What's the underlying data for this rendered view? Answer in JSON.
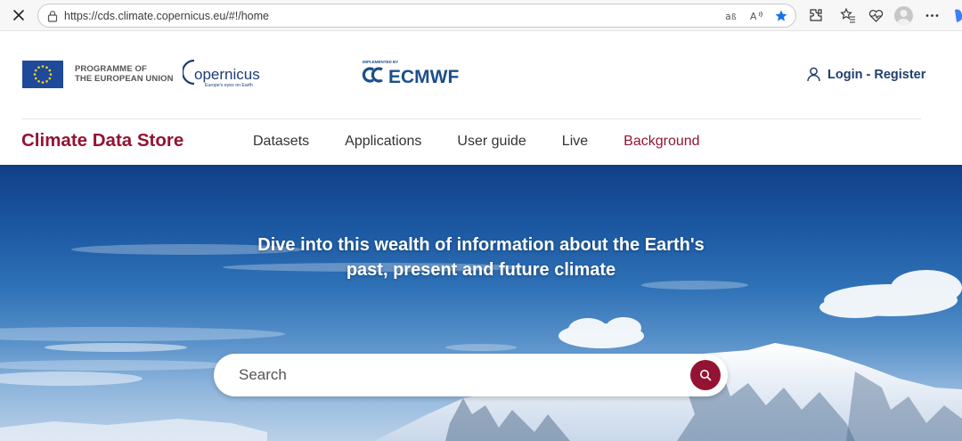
{
  "browser": {
    "url": "https://cds.climate.copernicus.eu/#!/home"
  },
  "header": {
    "eu_line1": "PROGRAMME OF",
    "eu_line2": "THE EUROPEAN UNION",
    "copernicus_logo": "opernicus",
    "copernicus_tagline": "Europe's eyes on Earth",
    "ecmwf_small": "IMPLEMENTED BY",
    "ecmwf_logo": "ECMWF",
    "login_label": "Login - Register"
  },
  "site": {
    "title": "Climate Data Store",
    "nav": [
      {
        "label": "Datasets"
      },
      {
        "label": "Applications"
      },
      {
        "label": "User guide"
      },
      {
        "label": "Live"
      },
      {
        "label": "Background"
      }
    ]
  },
  "hero": {
    "heading_line1": "Dive into this wealth of information about the Earth's",
    "heading_line2": "past, present and future climate",
    "search_placeholder": "Search"
  },
  "colors": {
    "brand": "#941333",
    "login": "#21406e",
    "ecmwf": "#1c4f8a"
  },
  "icons": [
    "close-icon",
    "lock-icon",
    "read-aloud-icon",
    "favorite-star-icon",
    "extensions-icon",
    "favorites-icon",
    "health-icon",
    "profile-avatar",
    "more-icon",
    "user-icon",
    "search-icon"
  ]
}
